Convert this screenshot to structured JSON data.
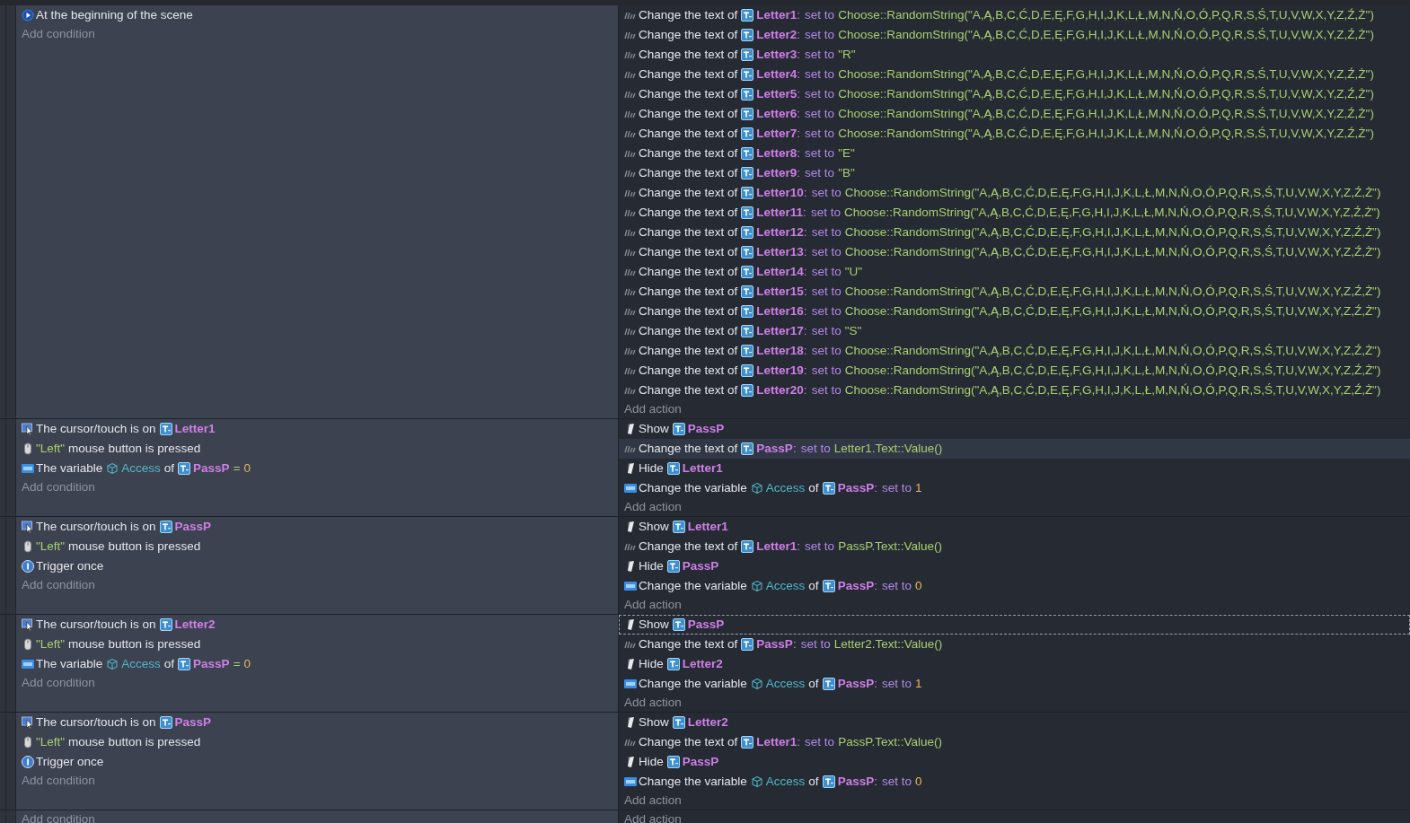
{
  "events": [
    {
      "conditions": [
        {
          "kind": "scene-start",
          "parts": [
            {
              "kind": "plain",
              "text": "At the beginning of the scene"
            }
          ]
        }
      ],
      "add_condition": "Add condition",
      "actions": [
        {
          "kind": "text-change",
          "selected": false,
          "hovered": false,
          "parts": [
            {
              "kind": "plain",
              "text": "Change the text of"
            },
            {
              "kind": "object",
              "text": "Letter1"
            },
            {
              "kind": "colon",
              "text": ":"
            },
            {
              "kind": "keyword",
              "text": "set to"
            },
            {
              "kind": "expression",
              "text": "Choose::RandomString(\"A,Ą,B,C,Ć,D,E,Ę,F,G,H,I,J,K,L,Ł,M,N,Ń,O,Ó,P,Q,R,S,Ś,T,U,V,W,X,Y,Z,Ź,Ż\")"
            }
          ]
        },
        {
          "kind": "text-change",
          "selected": false,
          "hovered": false,
          "parts": [
            {
              "kind": "plain",
              "text": "Change the text of"
            },
            {
              "kind": "object",
              "text": "Letter2"
            },
            {
              "kind": "colon",
              "text": ":"
            },
            {
              "kind": "keyword",
              "text": "set to"
            },
            {
              "kind": "expression",
              "text": "Choose::RandomString(\"A,Ą,B,C,Ć,D,E,Ę,F,G,H,I,J,K,L,Ł,M,N,Ń,O,Ó,P,Q,R,S,Ś,T,U,V,W,X,Y,Z,Ź,Ż\")"
            }
          ]
        },
        {
          "kind": "text-change",
          "selected": false,
          "hovered": false,
          "parts": [
            {
              "kind": "plain",
              "text": "Change the text of"
            },
            {
              "kind": "object",
              "text": "Letter3"
            },
            {
              "kind": "colon",
              "text": ":"
            },
            {
              "kind": "keyword",
              "text": "set to"
            },
            {
              "kind": "expression",
              "text": "\"R\""
            }
          ]
        },
        {
          "kind": "text-change",
          "selected": false,
          "hovered": false,
          "parts": [
            {
              "kind": "plain",
              "text": "Change the text of"
            },
            {
              "kind": "object",
              "text": "Letter4"
            },
            {
              "kind": "colon",
              "text": ":"
            },
            {
              "kind": "keyword",
              "text": "set to"
            },
            {
              "kind": "expression",
              "text": "Choose::RandomString(\"A,Ą,B,C,Ć,D,E,Ę,F,G,H,I,J,K,L,Ł,M,N,Ń,O,Ó,P,Q,R,S,Ś,T,U,V,W,X,Y,Z,Ź,Ż\")"
            }
          ]
        },
        {
          "kind": "text-change",
          "selected": false,
          "hovered": false,
          "parts": [
            {
              "kind": "plain",
              "text": "Change the text of"
            },
            {
              "kind": "object",
              "text": "Letter5"
            },
            {
              "kind": "colon",
              "text": ":"
            },
            {
              "kind": "keyword",
              "text": "set to"
            },
            {
              "kind": "expression",
              "text": "Choose::RandomString(\"A,Ą,B,C,Ć,D,E,Ę,F,G,H,I,J,K,L,Ł,M,N,Ń,O,Ó,P,Q,R,S,Ś,T,U,V,W,X,Y,Z,Ź,Ż\")"
            }
          ]
        },
        {
          "kind": "text-change",
          "selected": false,
          "hovered": false,
          "parts": [
            {
              "kind": "plain",
              "text": "Change the text of"
            },
            {
              "kind": "object",
              "text": "Letter6"
            },
            {
              "kind": "colon",
              "text": ":"
            },
            {
              "kind": "keyword",
              "text": "set to"
            },
            {
              "kind": "expression",
              "text": "Choose::RandomString(\"A,Ą,B,C,Ć,D,E,Ę,F,G,H,I,J,K,L,Ł,M,N,Ń,O,Ó,P,Q,R,S,Ś,T,U,V,W,X,Y,Z,Ź,Ż\")"
            }
          ]
        },
        {
          "kind": "text-change",
          "selected": false,
          "hovered": false,
          "parts": [
            {
              "kind": "plain",
              "text": "Change the text of"
            },
            {
              "kind": "object",
              "text": "Letter7"
            },
            {
              "kind": "colon",
              "text": ":"
            },
            {
              "kind": "keyword",
              "text": "set to"
            },
            {
              "kind": "expression",
              "text": "Choose::RandomString(\"A,Ą,B,C,Ć,D,E,Ę,F,G,H,I,J,K,L,Ł,M,N,Ń,O,Ó,P,Q,R,S,Ś,T,U,V,W,X,Y,Z,Ź,Ż\")"
            }
          ]
        },
        {
          "kind": "text-change",
          "selected": false,
          "hovered": false,
          "parts": [
            {
              "kind": "plain",
              "text": "Change the text of"
            },
            {
              "kind": "object",
              "text": "Letter8"
            },
            {
              "kind": "colon",
              "text": ":"
            },
            {
              "kind": "keyword",
              "text": "set to"
            },
            {
              "kind": "expression",
              "text": "\"E\""
            }
          ]
        },
        {
          "kind": "text-change",
          "selected": false,
          "hovered": false,
          "parts": [
            {
              "kind": "plain",
              "text": "Change the text of"
            },
            {
              "kind": "object",
              "text": "Letter9"
            },
            {
              "kind": "colon",
              "text": ":"
            },
            {
              "kind": "keyword",
              "text": "set to"
            },
            {
              "kind": "expression",
              "text": "\"B\""
            }
          ]
        },
        {
          "kind": "text-change",
          "selected": false,
          "hovered": false,
          "parts": [
            {
              "kind": "plain",
              "text": "Change the text of"
            },
            {
              "kind": "object",
              "text": "Letter10"
            },
            {
              "kind": "colon",
              "text": ":"
            },
            {
              "kind": "keyword",
              "text": "set to"
            },
            {
              "kind": "expression",
              "text": "Choose::RandomString(\"A,Ą,B,C,Ć,D,E,Ę,F,G,H,I,J,K,L,Ł,M,N,Ń,O,Ó,P,Q,R,S,Ś,T,U,V,W,X,Y,Z,Ź,Ż\")"
            }
          ]
        },
        {
          "kind": "text-change",
          "selected": false,
          "hovered": false,
          "parts": [
            {
              "kind": "plain",
              "text": "Change the text of"
            },
            {
              "kind": "object",
              "text": "Letter11"
            },
            {
              "kind": "colon",
              "text": ":"
            },
            {
              "kind": "keyword",
              "text": "set to"
            },
            {
              "kind": "expression",
              "text": "Choose::RandomString(\"A,Ą,B,C,Ć,D,E,Ę,F,G,H,I,J,K,L,Ł,M,N,Ń,O,Ó,P,Q,R,S,Ś,T,U,V,W,X,Y,Z,Ź,Ż\")"
            }
          ]
        },
        {
          "kind": "text-change",
          "selected": false,
          "hovered": false,
          "parts": [
            {
              "kind": "plain",
              "text": "Change the text of"
            },
            {
              "kind": "object",
              "text": "Letter12"
            },
            {
              "kind": "colon",
              "text": ":"
            },
            {
              "kind": "keyword",
              "text": "set to"
            },
            {
              "kind": "expression",
              "text": "Choose::RandomString(\"A,Ą,B,C,Ć,D,E,Ę,F,G,H,I,J,K,L,Ł,M,N,Ń,O,Ó,P,Q,R,S,Ś,T,U,V,W,X,Y,Z,Ź,Ż\")"
            }
          ]
        },
        {
          "kind": "text-change",
          "selected": false,
          "hovered": false,
          "parts": [
            {
              "kind": "plain",
              "text": "Change the text of"
            },
            {
              "kind": "object",
              "text": "Letter13"
            },
            {
              "kind": "colon",
              "text": ":"
            },
            {
              "kind": "keyword",
              "text": "set to"
            },
            {
              "kind": "expression",
              "text": "Choose::RandomString(\"A,Ą,B,C,Ć,D,E,Ę,F,G,H,I,J,K,L,Ł,M,N,Ń,O,Ó,P,Q,R,S,Ś,T,U,V,W,X,Y,Z,Ź,Ż\")"
            }
          ]
        },
        {
          "kind": "text-change",
          "selected": false,
          "hovered": false,
          "parts": [
            {
              "kind": "plain",
              "text": "Change the text of"
            },
            {
              "kind": "object",
              "text": "Letter14"
            },
            {
              "kind": "colon",
              "text": ":"
            },
            {
              "kind": "keyword",
              "text": "set to"
            },
            {
              "kind": "expression",
              "text": "\"U\""
            }
          ]
        },
        {
          "kind": "text-change",
          "selected": false,
          "hovered": false,
          "parts": [
            {
              "kind": "plain",
              "text": "Change the text of"
            },
            {
              "kind": "object",
              "text": "Letter15"
            },
            {
              "kind": "colon",
              "text": ":"
            },
            {
              "kind": "keyword",
              "text": "set to"
            },
            {
              "kind": "expression",
              "text": "Choose::RandomString(\"A,Ą,B,C,Ć,D,E,Ę,F,G,H,I,J,K,L,Ł,M,N,Ń,O,Ó,P,Q,R,S,Ś,T,U,V,W,X,Y,Z,Ź,Ż\")"
            }
          ]
        },
        {
          "kind": "text-change",
          "selected": false,
          "hovered": false,
          "parts": [
            {
              "kind": "plain",
              "text": "Change the text of"
            },
            {
              "kind": "object",
              "text": "Letter16"
            },
            {
              "kind": "colon",
              "text": ":"
            },
            {
              "kind": "keyword",
              "text": "set to"
            },
            {
              "kind": "expression",
              "text": "Choose::RandomString(\"A,Ą,B,C,Ć,D,E,Ę,F,G,H,I,J,K,L,Ł,M,N,Ń,O,Ó,P,Q,R,S,Ś,T,U,V,W,X,Y,Z,Ź,Ż\")"
            }
          ]
        },
        {
          "kind": "text-change",
          "selected": false,
          "hovered": false,
          "parts": [
            {
              "kind": "plain",
              "text": "Change the text of"
            },
            {
              "kind": "object",
              "text": "Letter17"
            },
            {
              "kind": "colon",
              "text": ":"
            },
            {
              "kind": "keyword",
              "text": "set to"
            },
            {
              "kind": "expression",
              "text": "\"S\""
            }
          ]
        },
        {
          "kind": "text-change",
          "selected": false,
          "hovered": false,
          "parts": [
            {
              "kind": "plain",
              "text": "Change the text of"
            },
            {
              "kind": "object",
              "text": "Letter18"
            },
            {
              "kind": "colon",
              "text": ":"
            },
            {
              "kind": "keyword",
              "text": "set to"
            },
            {
              "kind": "expression",
              "text": "Choose::RandomString(\"A,Ą,B,C,Ć,D,E,Ę,F,G,H,I,J,K,L,Ł,M,N,Ń,O,Ó,P,Q,R,S,Ś,T,U,V,W,X,Y,Z,Ź,Ż\")"
            }
          ]
        },
        {
          "kind": "text-change",
          "selected": false,
          "hovered": false,
          "parts": [
            {
              "kind": "plain",
              "text": "Change the text of"
            },
            {
              "kind": "object",
              "text": "Letter19"
            },
            {
              "kind": "colon",
              "text": ":"
            },
            {
              "kind": "keyword",
              "text": "set to"
            },
            {
              "kind": "expression",
              "text": "Choose::RandomString(\"A,Ą,B,C,Ć,D,E,Ę,F,G,H,I,J,K,L,Ł,M,N,Ń,O,Ó,P,Q,R,S,Ś,T,U,V,W,X,Y,Z,Ź,Ż\")"
            }
          ]
        },
        {
          "kind": "text-change",
          "selected": false,
          "hovered": false,
          "parts": [
            {
              "kind": "plain",
              "text": "Change the text of"
            },
            {
              "kind": "object",
              "text": "Letter20"
            },
            {
              "kind": "colon",
              "text": ":"
            },
            {
              "kind": "keyword",
              "text": "set to"
            },
            {
              "kind": "expression",
              "text": "Choose::RandomString(\"A,Ą,B,C,Ć,D,E,Ę,F,G,H,I,J,K,L,Ł,M,N,Ń,O,Ó,P,Q,R,S,Ś,T,U,V,W,X,Y,Z,Ź,Ż\")"
            }
          ]
        }
      ],
      "add_action": "Add action"
    },
    {
      "conditions": [
        {
          "kind": "cursor",
          "parts": [
            {
              "kind": "plain",
              "text": "The cursor/touch is on"
            },
            {
              "kind": "object",
              "text": "Letter1"
            }
          ]
        },
        {
          "kind": "mouse",
          "parts": [
            {
              "kind": "expression",
              "text": "\"Left\""
            },
            {
              "kind": "plain",
              "text": "mouse button is pressed"
            }
          ]
        },
        {
          "kind": "variable",
          "parts": [
            {
              "kind": "plain",
              "text": "The variable"
            },
            {
              "kind": "variable",
              "text": "Access"
            },
            {
              "kind": "plain",
              "text": "of"
            },
            {
              "kind": "object",
              "text": "PassP"
            },
            {
              "kind": "operator",
              "text": "="
            },
            {
              "kind": "number",
              "text": "0"
            }
          ]
        }
      ],
      "add_condition": "Add condition",
      "actions": [
        {
          "kind": "visibility",
          "selected": false,
          "hovered": false,
          "parts": [
            {
              "kind": "plain",
              "text": "Show"
            },
            {
              "kind": "object",
              "text": "PassP"
            }
          ]
        },
        {
          "kind": "text-change",
          "selected": false,
          "hovered": true,
          "parts": [
            {
              "kind": "plain",
              "text": "Change the text of"
            },
            {
              "kind": "object",
              "text": "PassP"
            },
            {
              "kind": "colon",
              "text": ":"
            },
            {
              "kind": "keyword",
              "text": "set to"
            },
            {
              "kind": "expression",
              "text": "Letter1.Text::Value()"
            }
          ]
        },
        {
          "kind": "visibility",
          "selected": false,
          "hovered": false,
          "parts": [
            {
              "kind": "plain",
              "text": "Hide"
            },
            {
              "kind": "object",
              "text": "Letter1"
            }
          ]
        },
        {
          "kind": "variable",
          "selected": false,
          "hovered": false,
          "parts": [
            {
              "kind": "plain",
              "text": "Change the variable"
            },
            {
              "kind": "variable",
              "text": "Access"
            },
            {
              "kind": "plain",
              "text": "of"
            },
            {
              "kind": "object",
              "text": "PassP"
            },
            {
              "kind": "colon",
              "text": ":"
            },
            {
              "kind": "keyword",
              "text": "set to"
            },
            {
              "kind": "number",
              "text": "1"
            }
          ]
        }
      ],
      "add_action": "Add action"
    },
    {
      "conditions": [
        {
          "kind": "cursor",
          "parts": [
            {
              "kind": "plain",
              "text": "The cursor/touch is on"
            },
            {
              "kind": "object",
              "text": "PassP"
            }
          ]
        },
        {
          "kind": "mouse",
          "parts": [
            {
              "kind": "expression",
              "text": "\"Left\""
            },
            {
              "kind": "plain",
              "text": "mouse button is pressed"
            }
          ]
        },
        {
          "kind": "trigger-once",
          "parts": [
            {
              "kind": "plain",
              "text": "Trigger once"
            }
          ]
        }
      ],
      "add_condition": "Add condition",
      "actions": [
        {
          "kind": "visibility",
          "selected": false,
          "hovered": false,
          "parts": [
            {
              "kind": "plain",
              "text": "Show"
            },
            {
              "kind": "object",
              "text": "Letter1"
            }
          ]
        },
        {
          "kind": "text-change",
          "selected": false,
          "hovered": false,
          "parts": [
            {
              "kind": "plain",
              "text": "Change the text of"
            },
            {
              "kind": "object",
              "text": "Letter1"
            },
            {
              "kind": "colon",
              "text": ":"
            },
            {
              "kind": "keyword",
              "text": "set to"
            },
            {
              "kind": "expression",
              "text": "PassP.Text::Value()"
            }
          ]
        },
        {
          "kind": "visibility",
          "selected": false,
          "hovered": false,
          "parts": [
            {
              "kind": "plain",
              "text": "Hide"
            },
            {
              "kind": "object",
              "text": "PassP"
            }
          ]
        },
        {
          "kind": "variable",
          "selected": false,
          "hovered": false,
          "parts": [
            {
              "kind": "plain",
              "text": "Change the variable"
            },
            {
              "kind": "variable",
              "text": "Access"
            },
            {
              "kind": "plain",
              "text": "of"
            },
            {
              "kind": "object",
              "text": "PassP"
            },
            {
              "kind": "colon",
              "text": ":"
            },
            {
              "kind": "keyword",
              "text": "set to"
            },
            {
              "kind": "number",
              "text": "0"
            }
          ]
        }
      ],
      "add_action": "Add action"
    },
    {
      "conditions": [
        {
          "kind": "cursor",
          "parts": [
            {
              "kind": "plain",
              "text": "The cursor/touch is on"
            },
            {
              "kind": "object",
              "text": "Letter2"
            }
          ]
        },
        {
          "kind": "mouse",
          "parts": [
            {
              "kind": "expression",
              "text": "\"Left\""
            },
            {
              "kind": "plain",
              "text": "mouse button is pressed"
            }
          ]
        },
        {
          "kind": "variable",
          "parts": [
            {
              "kind": "plain",
              "text": "The variable"
            },
            {
              "kind": "variable",
              "text": "Access"
            },
            {
              "kind": "plain",
              "text": "of"
            },
            {
              "kind": "object",
              "text": "PassP"
            },
            {
              "kind": "operator",
              "text": "="
            },
            {
              "kind": "number",
              "text": "0"
            }
          ]
        }
      ],
      "add_condition": "Add condition",
      "actions": [
        {
          "kind": "visibility",
          "selected": true,
          "hovered": false,
          "parts": [
            {
              "kind": "plain",
              "text": "Show"
            },
            {
              "kind": "object",
              "text": "PassP"
            }
          ]
        },
        {
          "kind": "text-change",
          "selected": false,
          "hovered": false,
          "parts": [
            {
              "kind": "plain",
              "text": "Change the text of"
            },
            {
              "kind": "object",
              "text": "PassP"
            },
            {
              "kind": "colon",
              "text": ":"
            },
            {
              "kind": "keyword",
              "text": "set to"
            },
            {
              "kind": "expression",
              "text": "Letter2.Text::Value()"
            }
          ]
        },
        {
          "kind": "visibility",
          "selected": false,
          "hovered": false,
          "parts": [
            {
              "kind": "plain",
              "text": "Hide"
            },
            {
              "kind": "object",
              "text": "Letter2"
            }
          ]
        },
        {
          "kind": "variable",
          "selected": false,
          "hovered": false,
          "parts": [
            {
              "kind": "plain",
              "text": "Change the variable"
            },
            {
              "kind": "variable",
              "text": "Access"
            },
            {
              "kind": "plain",
              "text": "of"
            },
            {
              "kind": "object",
              "text": "PassP"
            },
            {
              "kind": "colon",
              "text": ":"
            },
            {
              "kind": "keyword",
              "text": "set to"
            },
            {
              "kind": "number",
              "text": "1"
            }
          ]
        }
      ],
      "add_action": "Add action"
    },
    {
      "conditions": [
        {
          "kind": "cursor",
          "parts": [
            {
              "kind": "plain",
              "text": "The cursor/touch is on"
            },
            {
              "kind": "object",
              "text": "PassP"
            }
          ]
        },
        {
          "kind": "mouse",
          "parts": [
            {
              "kind": "expression",
              "text": "\"Left\""
            },
            {
              "kind": "plain",
              "text": "mouse button is pressed"
            }
          ]
        },
        {
          "kind": "trigger-once",
          "parts": [
            {
              "kind": "plain",
              "text": "Trigger once"
            }
          ]
        }
      ],
      "add_condition": "Add condition",
      "actions": [
        {
          "kind": "visibility",
          "selected": false,
          "hovered": false,
          "parts": [
            {
              "kind": "plain",
              "text": "Show"
            },
            {
              "kind": "object",
              "text": "Letter2"
            }
          ]
        },
        {
          "kind": "text-change",
          "selected": false,
          "hovered": false,
          "parts": [
            {
              "kind": "plain",
              "text": "Change the text of"
            },
            {
              "kind": "object",
              "text": "Letter1"
            },
            {
              "kind": "colon",
              "text": ":"
            },
            {
              "kind": "keyword",
              "text": "set to"
            },
            {
              "kind": "expression",
              "text": "PassP.Text::Value()"
            }
          ]
        },
        {
          "kind": "visibility",
          "selected": false,
          "hovered": false,
          "parts": [
            {
              "kind": "plain",
              "text": "Hide"
            },
            {
              "kind": "object",
              "text": "PassP"
            }
          ]
        },
        {
          "kind": "variable",
          "selected": false,
          "hovered": false,
          "parts": [
            {
              "kind": "plain",
              "text": "Change the variable"
            },
            {
              "kind": "variable",
              "text": "Access"
            },
            {
              "kind": "plain",
              "text": "of"
            },
            {
              "kind": "object",
              "text": "PassP"
            },
            {
              "kind": "colon",
              "text": ":"
            },
            {
              "kind": "keyword",
              "text": "set to"
            },
            {
              "kind": "number",
              "text": "0"
            }
          ]
        }
      ],
      "add_action": "Add action"
    },
    {
      "add_condition": "Add condition",
      "add_action": "Add action"
    }
  ]
}
